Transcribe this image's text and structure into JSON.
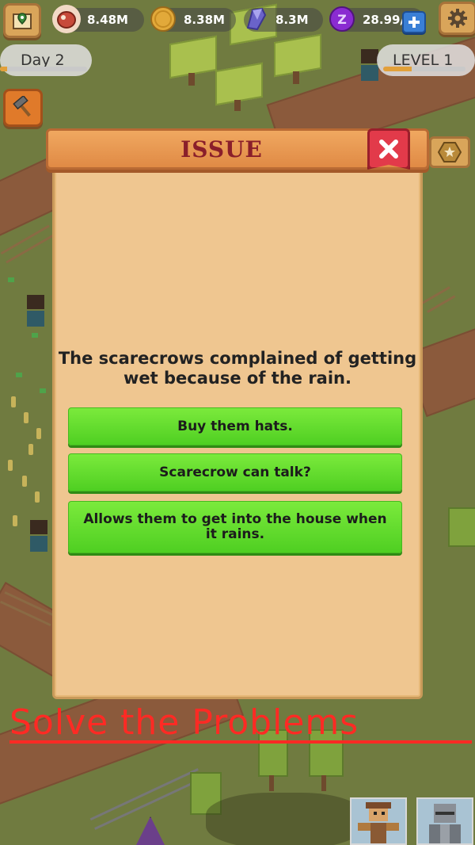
{
  "resources": [
    {
      "name": "meat",
      "icon": "meat-icon",
      "value": "8.48M",
      "color": "#c74a3a"
    },
    {
      "name": "coins",
      "icon": "coin-icon",
      "value": "8.38M",
      "color": "#e2a93a"
    },
    {
      "name": "crystal",
      "icon": "crystal-icon",
      "value": "8.3M",
      "color": "#6a63c9"
    },
    {
      "name": "premium",
      "icon": "premium-coin-icon",
      "value": "28.99/",
      "color": "#8a2bd1"
    }
  ],
  "day": {
    "label": "Day 2",
    "progress": 0.08
  },
  "level": {
    "label": "LEVEL 1",
    "progress": 0.35
  },
  "dialog": {
    "title": "ISSUE",
    "question": "The scarecrows complained of getting wet because of the rain.",
    "options": [
      {
        "label": "Buy them hats."
      },
      {
        "label": "Scarecrow can talk?"
      },
      {
        "label": "Allows them to get into the house when it rains."
      }
    ]
  },
  "promo": {
    "text": "Solve the Problems",
    "color": "#ff2a24"
  },
  "colors": {
    "option_green": "#5fd92c",
    "panel": "#efc690",
    "banner": "#e8944c",
    "close": "#e23a4a"
  }
}
